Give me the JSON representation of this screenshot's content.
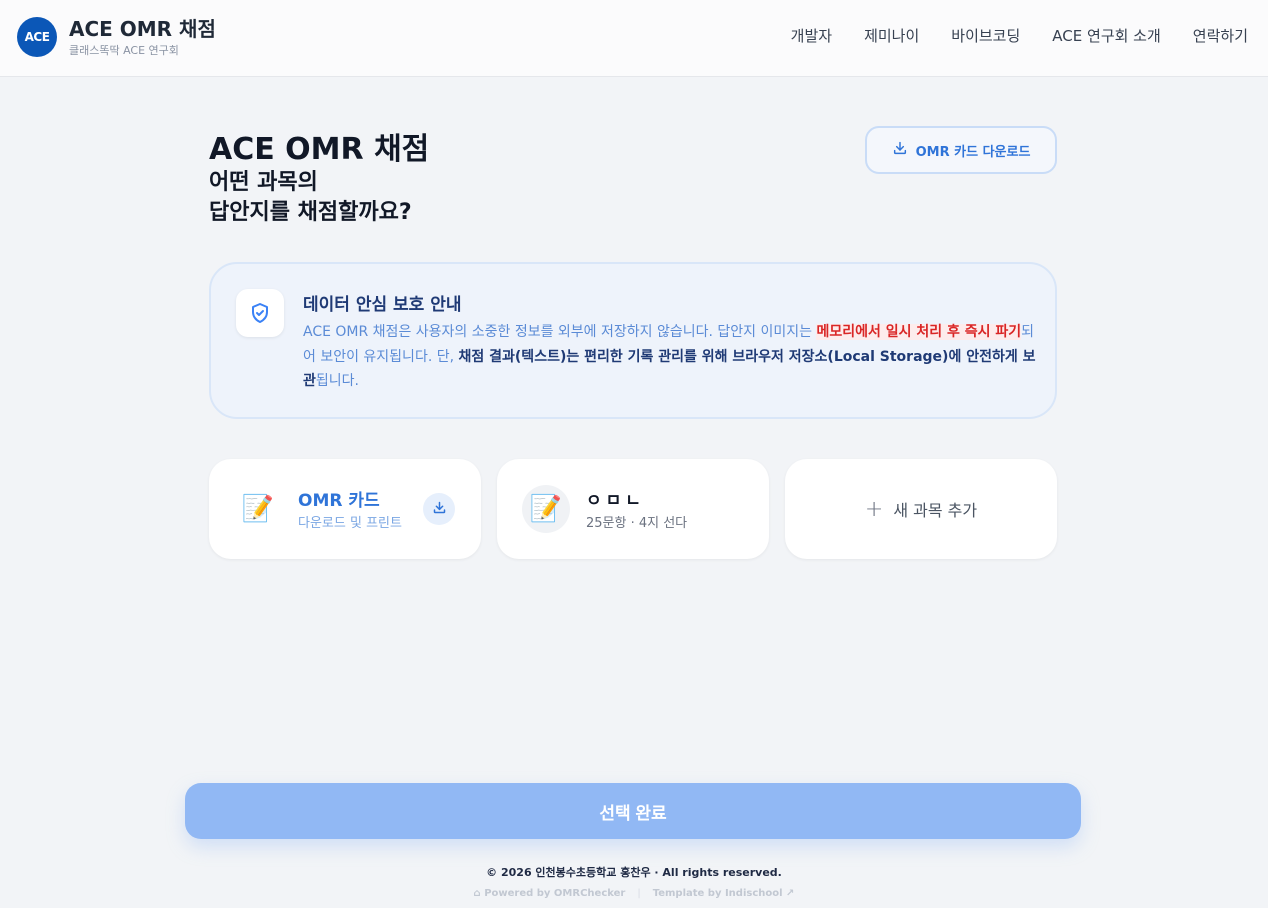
{
  "header": {
    "logo": "ACE",
    "title": "ACE OMR 채점",
    "subtitle": "클래스똑딱 ACE 연구회",
    "nav": [
      "개발자",
      "제미나이",
      "바이브코딩",
      "ACE 연구회 소개",
      "연락하기"
    ]
  },
  "main": {
    "title": "ACE OMR 채점",
    "question_line1": "어떤 과목의",
    "question_line2": "답안지를 채점할까요?",
    "download_button": "OMR 카드 다운로드"
  },
  "notice": {
    "title": "데이터 안심 보호 안내",
    "text1": "ACE OMR 채점은 사용자의 소중한 정보를 외부에 저장하지 않습니다. 답안지 이미지는 ",
    "red": "메모리에서 일시 처리 후 즉시 파기",
    "text2": "되어 보안이 유지됩니다. 단, ",
    "strong": "채점 결과(텍스트)는 편리한 기록 관리를 위해 브라우저 저장소(Local Storage)에 안전하게 보관",
    "text3": "됩니다."
  },
  "cards": [
    {
      "icon": "memo-icon",
      "title": "OMR 카드",
      "subtitle": "다운로드 및 프린트"
    },
    {
      "icon": "memo-icon",
      "title": "ㅇㅁㄴ",
      "subtitle": "25문항 · 4지 선다"
    }
  ],
  "add_card_label": "새 과목 추가",
  "complete_button": "선택 완료",
  "footer": {
    "copyright": "© 2026 인천봉수초등학교 홍찬우 · All rights reserved.",
    "powered": "Powered by OMRChecker",
    "template": "Template by Indischool"
  },
  "colors": {
    "brand": "#0b57b7",
    "accent": "#2f74d8",
    "button": "#91b8f4",
    "danger": "#d92626"
  }
}
